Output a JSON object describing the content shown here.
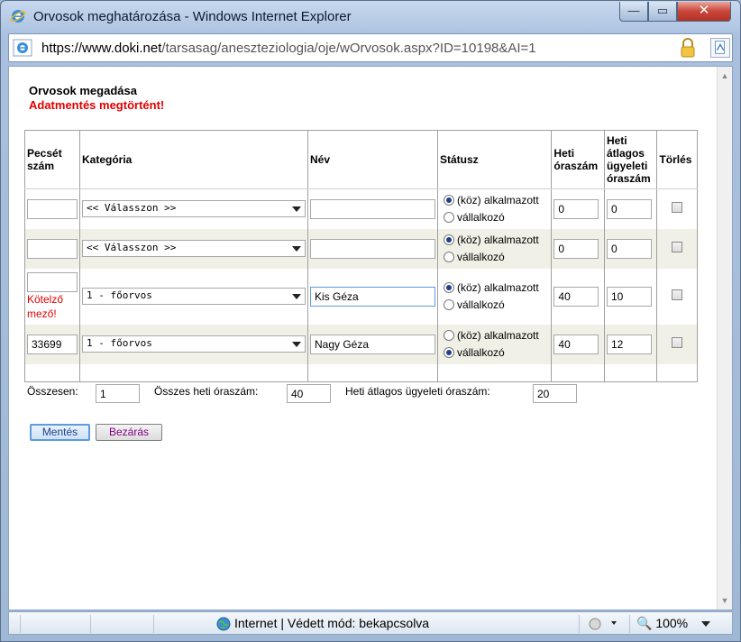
{
  "window": {
    "title": "Orvosok meghatározása - Windows Internet Explorer",
    "min": "—",
    "max": "▭",
    "close": "✕"
  },
  "address": {
    "host": "https://www.doki.net",
    "path": "/tarsasag/aneszteziologia/oje/wOrvosok.aspx?ID=10198&AI=1"
  },
  "page": {
    "heading": "Orvosok megadása",
    "saved_msg": "Adatmentés megtörtént!"
  },
  "table": {
    "headers": {
      "pecset": "Pecsét szám",
      "kategoria": "Kategória",
      "nev": "Név",
      "statusz": "Státusz",
      "heti": "Heti óraszám",
      "ugyeleti": "Heti átlagos ügyeleti óraszám",
      "torles": "Törlés"
    },
    "radio_labels": {
      "alkalmazott": "(köz) alkalmazott",
      "vallalkozo": "vállalkozó"
    },
    "required_label": "Kötelző mező!",
    "rows": [
      {
        "pecset": "",
        "kategoria": "<< Válasszon >>",
        "nev": "",
        "status": "alkalmazott",
        "heti": "0",
        "ugyeleti": "0"
      },
      {
        "pecset": "",
        "kategoria": "<< Válasszon >>",
        "nev": "",
        "status": "alkalmazott",
        "heti": "0",
        "ugyeleti": "0"
      },
      {
        "pecset": "",
        "kategoria": "1 - főorvos",
        "nev": "Kis Géza",
        "status": "alkalmazott",
        "heti": "40",
        "ugyeleti": "10"
      },
      {
        "pecset": "33699",
        "kategoria": "1 - főorvos",
        "nev": "Nagy Géza",
        "status": "vallalkozo",
        "heti": "40",
        "ugyeleti": "12"
      }
    ]
  },
  "summary": {
    "osszesen_label": "Összesen:",
    "osszesen_value": "1",
    "heti_label": "Összes heti óraszám:",
    "heti_value": "40",
    "ugyeleti_label": "Heti átlagos ügyeleti óraszám:",
    "ugyeleti_value": "20"
  },
  "buttons": {
    "save": "Mentés",
    "close": "Bezárás"
  },
  "statusbar": {
    "zone": "Internet | Védett mód: bekapcsolva",
    "zoom": "100%"
  }
}
